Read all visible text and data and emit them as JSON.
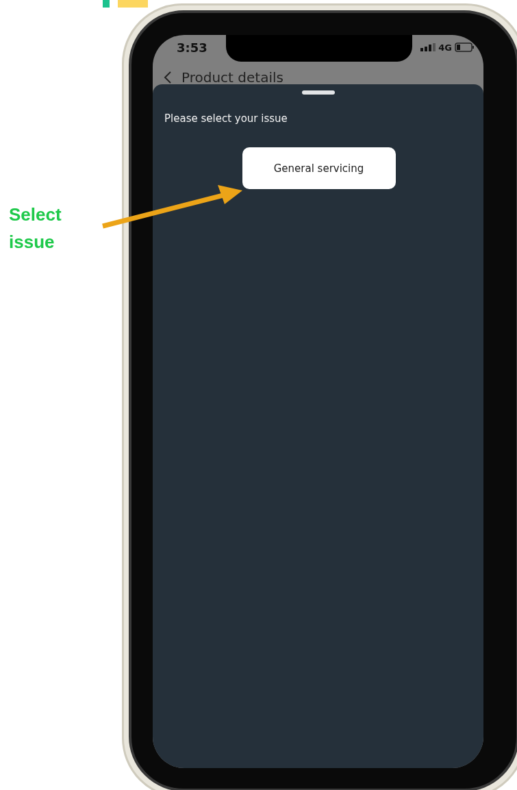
{
  "annotation": {
    "text": "Select issue"
  },
  "status_bar": {
    "time": "3:53",
    "network": "4G"
  },
  "header": {
    "title": "Product details"
  },
  "sheet": {
    "prompt": "Please select your issue",
    "options": [
      {
        "label": "General servicing"
      }
    ]
  }
}
